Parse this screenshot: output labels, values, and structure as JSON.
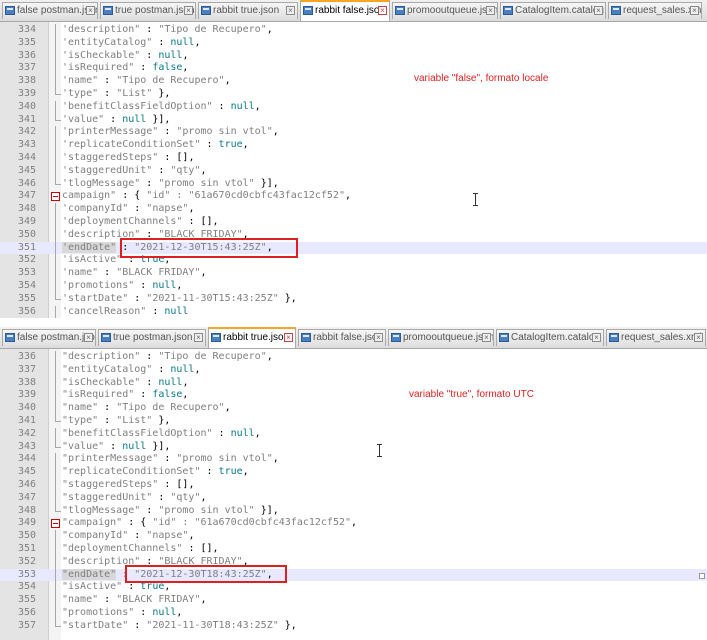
{
  "panel1": {
    "tabs": [
      {
        "label": "false postman.json",
        "active": false
      },
      {
        "label": "true postman.json",
        "active": false
      },
      {
        "label": "rabbit true.json",
        "active": false
      },
      {
        "label": "rabbit false.json",
        "active": true
      },
      {
        "label": "promooutqueue.json",
        "active": false
      },
      {
        "label": "CatalogItem.catalog",
        "active": false
      },
      {
        "label": "request_sales.xml",
        "active": false
      }
    ],
    "annotation": "variable \"false\", formato locale",
    "lines": [
      {
        "n": "334",
        "fold": "vline",
        "key": "'description\"",
        "sep": " : ",
        "val": "\"Tipo de Recupero\"",
        "vt": "s",
        "tail": ","
      },
      {
        "n": "335",
        "fold": "vline",
        "key": "'entityCatalog\"",
        "sep": " : ",
        "val": "null",
        "vt": "kw",
        "tail": ","
      },
      {
        "n": "336",
        "fold": "vline",
        "key": "'isCheckable\"",
        "sep": " : ",
        "val": "null",
        "vt": "kw",
        "tail": ","
      },
      {
        "n": "337",
        "fold": "vline",
        "key": "'isRequired\"",
        "sep": " : ",
        "val": "false",
        "vt": "kw",
        "tail": ","
      },
      {
        "n": "338",
        "fold": "vline",
        "key": "'name\"",
        "sep": " : ",
        "val": "\"Tipo de Recupero\"",
        "vt": "s",
        "tail": ","
      },
      {
        "n": "339",
        "fold": "end",
        "key": "'type\"",
        "sep": " : ",
        "val": "\"List\"",
        "vt": "s",
        "tail": " },"
      },
      {
        "n": "340",
        "fold": "vline",
        "key": "'benefitClassFieldOption\"",
        "sep": " : ",
        "val": "null",
        "vt": "kw",
        "tail": ","
      },
      {
        "n": "341",
        "fold": "end",
        "key": "'value\"",
        "sep": " : ",
        "val": "null",
        "vt": "kw",
        "tail": " }],"
      },
      {
        "n": "342",
        "fold": "vline",
        "key": "'printerMessage\"",
        "sep": " : ",
        "val": "\"promo sin vtol\"",
        "vt": "s",
        "tail": ","
      },
      {
        "n": "343",
        "fold": "vline",
        "key": "'replicateConditionSet\"",
        "sep": " : ",
        "val": "true",
        "vt": "kw",
        "tail": ","
      },
      {
        "n": "344",
        "fold": "vline",
        "key": "'staggeredSteps\"",
        "sep": " : ",
        "val": "[]",
        "vt": "",
        "tail": ","
      },
      {
        "n": "345",
        "fold": "vline",
        "key": "'staggeredUnit\"",
        "sep": " : ",
        "val": "\"qty\"",
        "vt": "s",
        "tail": ","
      },
      {
        "n": "346",
        "fold": "end",
        "key": "'tlogMessage\"",
        "sep": " : ",
        "val": "\"promo sin vtol\"",
        "vt": "s",
        "tail": " }],"
      },
      {
        "n": "347",
        "fold": "box",
        "key": "campaign\"",
        "sep": " : { ",
        "val": "\"id\" : \"61a670cd0cbfc43fac12cf52\"",
        "vt": "s",
        "tail": ","
      },
      {
        "n": "348",
        "fold": "vline",
        "key": "'companyId\"",
        "sep": " : ",
        "val": "\"napse\"",
        "vt": "s",
        "tail": ","
      },
      {
        "n": "349",
        "fold": "vline",
        "key": "'deploymentChannels\"",
        "sep": " : ",
        "val": "[]",
        "vt": "",
        "tail": ","
      },
      {
        "n": "350",
        "fold": "vline",
        "key": "'description\"",
        "sep": " : ",
        "val": "\"BLACK FRIDAY\"",
        "vt": "s",
        "tail": ","
      },
      {
        "n": "351",
        "fold": "vline",
        "key": "'endDate\"",
        "sep": " : ",
        "val": "\"2021-12-30T15:43:25Z\"",
        "vt": "s",
        "tail": ",",
        "current": true
      },
      {
        "n": "352",
        "fold": "vline",
        "key": "'isActive\"",
        "sep": " : ",
        "val": "true",
        "vt": "kw",
        "tail": ","
      },
      {
        "n": "353",
        "fold": "vline",
        "key": "'name\"",
        "sep": " : ",
        "val": "\"BLACK FRIDAY\"",
        "vt": "s",
        "tail": ","
      },
      {
        "n": "354",
        "fold": "vline",
        "key": "'promotions\"",
        "sep": " : ",
        "val": "null",
        "vt": "kw",
        "tail": ","
      },
      {
        "n": "355",
        "fold": "end",
        "key": "'startDate\"",
        "sep": " : ",
        "val": "\"2021-11-30T15:43:25Z\"",
        "vt": "s",
        "tail": " },"
      },
      {
        "n": "356",
        "fold": "vline",
        "key": "'cancelReason\"",
        "sep": " : ",
        "val": "null",
        "vt": "kw",
        "tail": ""
      }
    ]
  },
  "panel2": {
    "tabs": [
      {
        "label": "false postman.json",
        "active": false
      },
      {
        "label": "true postman.json",
        "active": false
      },
      {
        "label": "rabbit true.json",
        "active": true
      },
      {
        "label": "rabbit false.json",
        "active": false
      },
      {
        "label": "promooutqueue.json",
        "active": false
      },
      {
        "label": "CatalogItem.catalog",
        "active": false
      },
      {
        "label": "request_sales.xml",
        "active": false
      }
    ],
    "annotation": "variable \"true\", formato UTC",
    "lines": [
      {
        "n": "336",
        "fold": "vline",
        "key": "\"description\"",
        "sep": " : ",
        "val": "\"Tipo de Recupero\"",
        "vt": "s",
        "tail": ","
      },
      {
        "n": "337",
        "fold": "vline",
        "key": "\"entityCatalog\"",
        "sep": " : ",
        "val": "null",
        "vt": "kw",
        "tail": ","
      },
      {
        "n": "338",
        "fold": "vline",
        "key": "\"isCheckable\"",
        "sep": " : ",
        "val": "null",
        "vt": "kw",
        "tail": ","
      },
      {
        "n": "339",
        "fold": "vline",
        "key": "\"isRequired\"",
        "sep": " : ",
        "val": "false",
        "vt": "kw",
        "tail": ","
      },
      {
        "n": "340",
        "fold": "vline",
        "key": "\"name\"",
        "sep": " : ",
        "val": "\"Tipo de Recupero\"",
        "vt": "s",
        "tail": ","
      },
      {
        "n": "341",
        "fold": "end",
        "key": "\"type\"",
        "sep": " : ",
        "val": "\"List\"",
        "vt": "s",
        "tail": " },"
      },
      {
        "n": "342",
        "fold": "vline",
        "key": "\"benefitClassFieldOption\"",
        "sep": " : ",
        "val": "null",
        "vt": "kw",
        "tail": ","
      },
      {
        "n": "343",
        "fold": "end",
        "key": "\"value\"",
        "sep": " : ",
        "val": "null",
        "vt": "kw",
        "tail": " }],"
      },
      {
        "n": "344",
        "fold": "vline",
        "key": "\"printerMessage\"",
        "sep": " : ",
        "val": "\"promo sin vtol\"",
        "vt": "s",
        "tail": ","
      },
      {
        "n": "345",
        "fold": "vline",
        "key": "\"replicateConditionSet\"",
        "sep": " : ",
        "val": "true",
        "vt": "kw",
        "tail": ","
      },
      {
        "n": "346",
        "fold": "vline",
        "key": "\"staggeredSteps\"",
        "sep": " : ",
        "val": "[]",
        "vt": "",
        "tail": ","
      },
      {
        "n": "347",
        "fold": "vline",
        "key": "\"staggeredUnit\"",
        "sep": " : ",
        "val": "\"qty\"",
        "vt": "s",
        "tail": ","
      },
      {
        "n": "348",
        "fold": "end",
        "key": "\"tlogMessage\"",
        "sep": " : ",
        "val": "\"promo sin vtol\"",
        "vt": "s",
        "tail": " }],"
      },
      {
        "n": "349",
        "fold": "box",
        "key": "\"campaign\"",
        "sep": " : { ",
        "val": "\"id\" : \"61a670cd0cbfc43fac12cf52\"",
        "vt": "s",
        "tail": ","
      },
      {
        "n": "350",
        "fold": "vline",
        "key": "\"companyId\"",
        "sep": " : ",
        "val": "\"napse\"",
        "vt": "s",
        "tail": ","
      },
      {
        "n": "351",
        "fold": "vline",
        "key": "\"deploymentChannels\"",
        "sep": " : ",
        "val": "[]",
        "vt": "",
        "tail": ","
      },
      {
        "n": "352",
        "fold": "vline",
        "key": "\"description\"",
        "sep": " : ",
        "val": "\"BLACK FRIDAY\"",
        "vt": "s",
        "tail": ","
      },
      {
        "n": "353",
        "fold": "vline",
        "key": "\"endDate\"",
        "sep": " : ",
        "val": "\"2021-12-30T18:43:25Z\"",
        "vt": "s",
        "tail": ",",
        "current": true
      },
      {
        "n": "354",
        "fold": "vline",
        "key": "\"isActive\"",
        "sep": " : ",
        "val": "true",
        "vt": "kw",
        "tail": ","
      },
      {
        "n": "355",
        "fold": "vline",
        "key": "\"name\"",
        "sep": " : ",
        "val": "\"BLACK FRIDAY\"",
        "vt": "s",
        "tail": ","
      },
      {
        "n": "356",
        "fold": "vline",
        "key": "\"promotions\"",
        "sep": " : ",
        "val": "null",
        "vt": "kw",
        "tail": ","
      },
      {
        "n": "357",
        "fold": "end",
        "key": "\"startDate\"",
        "sep": " : ",
        "val": "\"2021-11-30T18:43:25Z\"",
        "vt": "s",
        "tail": " },"
      }
    ]
  },
  "colors": {
    "annotation": "#e02020",
    "keyword": "#0a7a8a",
    "active_tab_accent": "#f5a623",
    "current_line": "#e8e8ff"
  },
  "icons": {
    "tab_icon": "save-file-icon",
    "tab_close": "close-icon",
    "fold_marker": "fold-collapse-icon",
    "text_cursor": "ibeam-cursor-icon"
  }
}
